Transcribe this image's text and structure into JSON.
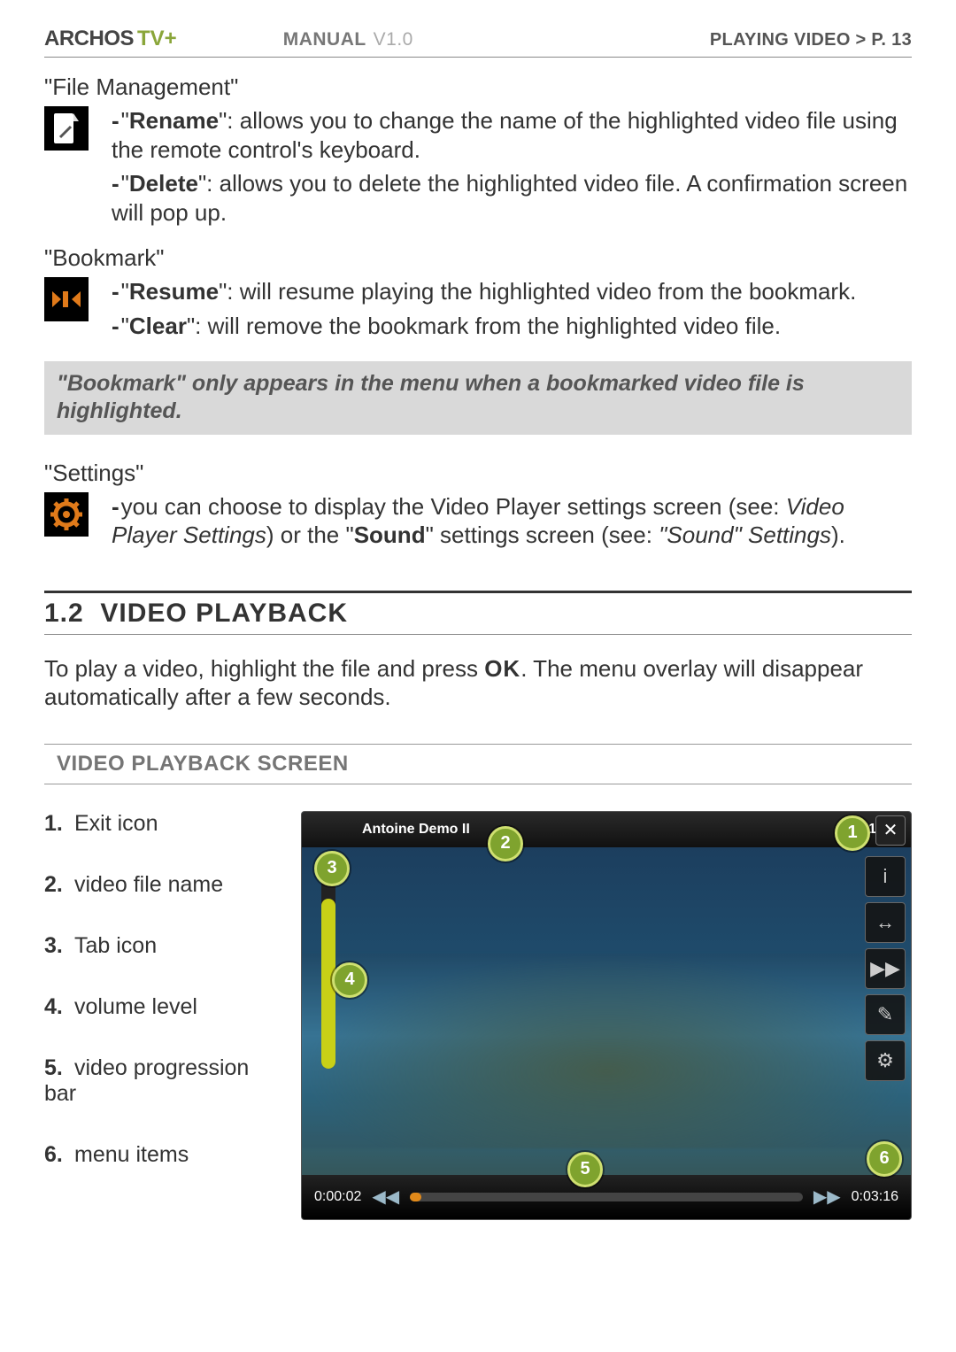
{
  "header": {
    "brand": "ARCHOS",
    "tvplus": "TV+",
    "manual_label": "MANUAL",
    "version": "V1.0",
    "right": "PLAYING VIDEO   >   P. 13"
  },
  "sections": {
    "file_mgmt": {
      "title": "\"File Management\"",
      "items": {
        "rename_label": "Rename",
        "rename_text": "\": allows you to change the name of the highlighted video file using the remote control's keyboard.",
        "delete_label": "Delete",
        "delete_text": "\": allows you to delete the highlighted video file. A confirmation screen will pop up."
      }
    },
    "bookmark": {
      "title": "\"Bookmark\"",
      "items": {
        "resume_label": "Resume",
        "resume_text": "\": will resume playing the highlighted video from the bookmark.",
        "clear_label": "Clear",
        "clear_text": "\": will remove the bookmark from the highlighted video file."
      },
      "note": "\"Bookmark\" only appears in the menu when a bookmarked video file is highlighted."
    },
    "settings": {
      "title": "\"Settings\"",
      "text_before": "you can choose to display the Video Player settings screen (see: ",
      "italic_1": "Video Player Settings",
      "mid": ") or the \"",
      "bold_1": "Sound",
      "after_bold": "\" settings screen (see: ",
      "italic_2": "\"Sound\" Settings",
      "end": ")."
    }
  },
  "section_1_2": {
    "number": "1.2",
    "title": "VIDEO PLAYBACK",
    "body_before": "To play a video, highlight the file and press ",
    "ok": "OK",
    "body_after": ". The menu overlay will disappear automatically after a few seconds.",
    "sub": "VIDEO PLAYBACK SCREEN",
    "list": {
      "i1": "Exit icon",
      "i2": "video file name",
      "i3": "Tab icon",
      "i4": "volume level",
      "i5": "video progression bar",
      "i6": "menu items"
    },
    "nums": {
      "n1": "1.",
      "n2": "2.",
      "n3": "3.",
      "n4": "4.",
      "n5": "5.",
      "n6": "6."
    }
  },
  "player": {
    "title": "Antoine Demo II",
    "clock": "15 48",
    "start_time": "0:00:02",
    "end_time": "0:03:16",
    "callouts": {
      "c1": "1",
      "c2": "2",
      "c3": "3",
      "c4": "4",
      "c5": "5",
      "c6": "6"
    }
  }
}
